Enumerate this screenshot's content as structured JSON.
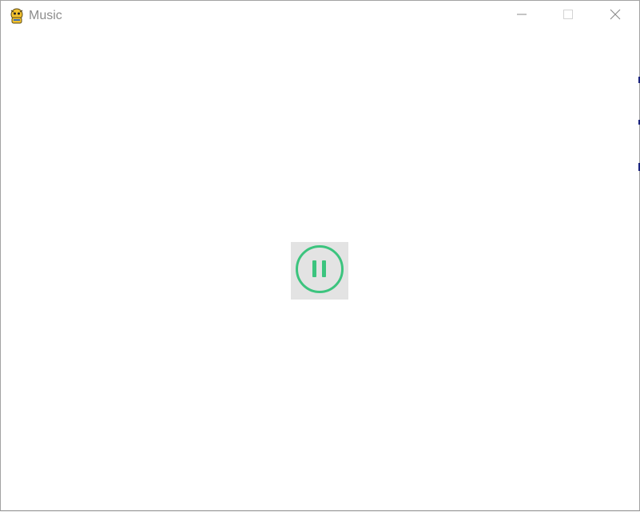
{
  "window": {
    "title": "Music",
    "app_icon": "python-snake-icon",
    "controls": {
      "minimize": "minimize-icon",
      "maximize": "maximize-icon",
      "close": "close-icon"
    }
  },
  "player": {
    "state_icon": "pause-circle-icon",
    "accent_color": "#3cc47e",
    "button_background": "#e3e3e3"
  }
}
